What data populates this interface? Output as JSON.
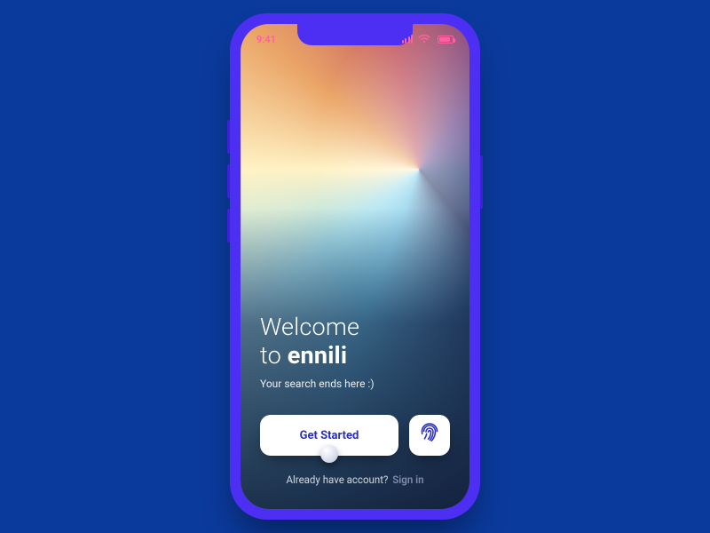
{
  "status_bar": {
    "time": "9:41"
  },
  "welcome": {
    "line1": "Welcome",
    "line2_prefix": "to ",
    "brand": "ennili",
    "subtitle": "Your search ends here :)"
  },
  "cta": {
    "primary_label": "Get Started"
  },
  "signin": {
    "prompt": "Already have account?",
    "link_label": "Sign in"
  }
}
